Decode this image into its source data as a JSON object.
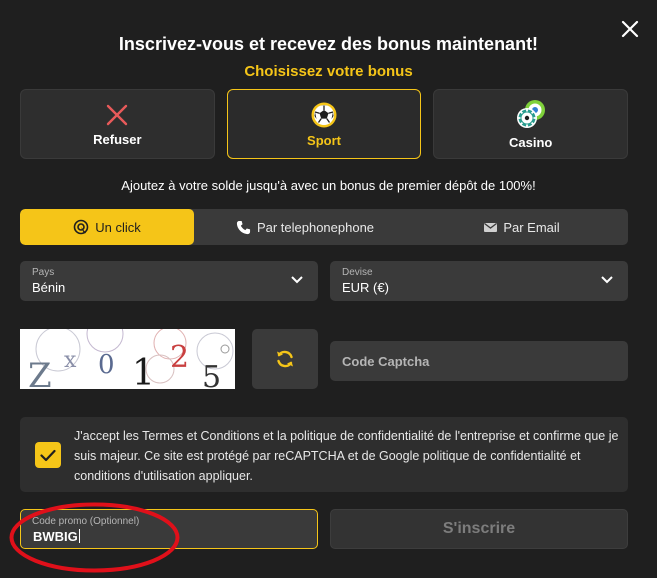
{
  "modal": {
    "title": "Inscrivez-vous et recevez des bonus maintenant!",
    "subtitle": "Choisissez votre bonus",
    "promo_text": "Ajoutez à votre solde jusqu'à avec un bonus de premier dépôt de 100%!"
  },
  "bonus_options": [
    {
      "label": "Refuser",
      "icon": "close-x-icon"
    },
    {
      "label": "Sport",
      "icon": "soccer-ball-icon",
      "selected": true
    },
    {
      "label": "Casino",
      "icon": "casino-chips-icon"
    }
  ],
  "tabs": [
    {
      "label": "Un click",
      "icon": "one-click-icon",
      "active": true
    },
    {
      "label": "Par telephonephone",
      "icon": "phone-icon"
    },
    {
      "label": "Par Email",
      "icon": "envelope-icon"
    }
  ],
  "country": {
    "caption": "Pays",
    "value": "Bénin"
  },
  "currency": {
    "caption": "Devise",
    "value": "EUR (€)"
  },
  "captcha": {
    "characters": [
      "Z",
      "x",
      "0",
      "1",
      "2",
      "5"
    ],
    "input_placeholder": "Code Captcha"
  },
  "terms": {
    "checked": true,
    "text": "J'accept les Termes et Conditions et la politique de confidentialité de l'entreprise et confirme que je suis majeur. Ce site est protégé par reCAPTCHA et de Google politique de confidentialité et conditions d'utilisation appliquer."
  },
  "promo_code": {
    "caption": "Code promo (Optionnel)",
    "value": "BWBIG"
  },
  "submit": {
    "label": "S'inscrire"
  },
  "colors": {
    "accent": "#f5c518",
    "background": "#1f1f1f",
    "field": "#3a3a3a",
    "annotation": "#e0101a"
  }
}
